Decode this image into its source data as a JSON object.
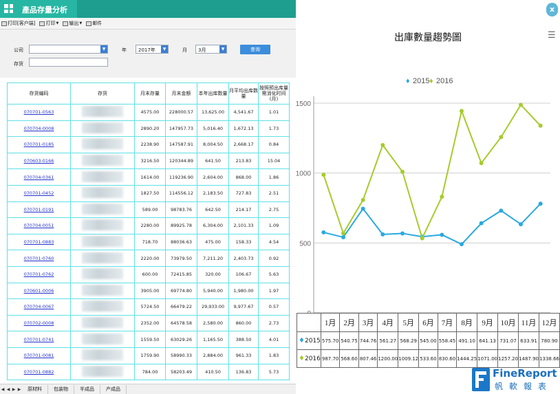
{
  "window": {
    "title": "產品存量分析"
  },
  "toolbar": {
    "print_client": "打印[客户端]",
    "print": "打印",
    "export": "输出",
    "email": "邮件"
  },
  "params": {
    "company_label": "公司",
    "company_value": "",
    "year_label": "年",
    "year_value": "2017年",
    "month_label": "月",
    "month_value": "3月",
    "query_button": "查询",
    "stock_label": "存货",
    "stock_value": ""
  },
  "grid": {
    "headers": [
      "存货编码",
      "存货",
      "月末存量",
      "月末金额",
      "本年出库数量",
      "月平均出库数量",
      "按照预出库量需消化时间(月)"
    ],
    "rows": [
      [
        "070701-0563",
        "",
        "4575.00",
        "228000.57",
        "13,625.00",
        "4,541.67",
        "1.01"
      ],
      [
        "070704-0008",
        "",
        "2890.20",
        "147957.73",
        "5,016.40",
        "1,672.13",
        "1.73"
      ],
      [
        "070701-0185",
        "",
        "2238.90",
        "147587.91",
        "8,004.50",
        "2,668.17",
        "0.84"
      ],
      [
        "070603-0166",
        "",
        "3216.50",
        "120344.89",
        "641.50",
        "213.83",
        "15.04"
      ],
      [
        "070704-0361",
        "",
        "1614.00",
        "119236.90",
        "2,604.00",
        "868.00",
        "1.86"
      ],
      [
        "070701-0452",
        "",
        "1827.50",
        "114556.12",
        "2,183.50",
        "727.83",
        "2.51"
      ],
      [
        "070701-0191",
        "",
        "589.00",
        "98783.76",
        "642.50",
        "214.17",
        "2.75"
      ],
      [
        "070704-0051",
        "",
        "2280.00",
        "89925.78",
        "6,304.00",
        "2,101.33",
        "1.09"
      ],
      [
        "070701-0883",
        "",
        "718.70",
        "88036.63",
        "475.00",
        "158.33",
        "4.54"
      ],
      [
        "070701-0760",
        "",
        "2220.00",
        "73979.50",
        "7,211.20",
        "2,403.73",
        "0.92"
      ],
      [
        "070701-0762",
        "",
        "600.00",
        "72415.85",
        "320.00",
        "106.67",
        "5.63"
      ],
      [
        "070601-0006",
        "",
        "3905.00",
        "69774.80",
        "5,940.00",
        "1,980.00",
        "1.97"
      ],
      [
        "070704-0067",
        "",
        "5724.50",
        "66479.22",
        "29,933.00",
        "9,977.67",
        "0.57"
      ],
      [
        "070702-0008",
        "",
        "2352.00",
        "64578.58",
        "2,580.00",
        "860.00",
        "2.73"
      ],
      [
        "070701-0741",
        "",
        "1559.50",
        "63029.26",
        "1,165.50",
        "388.50",
        "4.01"
      ],
      [
        "070701-0081",
        "",
        "1759.90",
        "58990.33",
        "2,884.00",
        "961.33",
        "1.83"
      ],
      [
        "070701-0882",
        "",
        "784.00",
        "58203.49",
        "410.50",
        "136.83",
        "5.73"
      ]
    ]
  },
  "sheet_tabs": [
    "原材料",
    "包装物",
    "半成品",
    "产成品"
  ],
  "chart_panel": {
    "close_label": "x",
    "menu_icon": "menu-icon"
  },
  "chart_data": {
    "type": "line",
    "title": "出庫數量趨勢圖",
    "categories": [
      "1月",
      "2月",
      "3月",
      "4月",
      "5月",
      "6月",
      "7月",
      "8月",
      "9月",
      "10月",
      "11月",
      "12月"
    ],
    "series": [
      {
        "name": "2015",
        "color": "#29a9e0",
        "values": [
          575.7,
          540.75,
          744.76,
          561.27,
          568.29,
          545.0,
          558.45,
          491.1,
          641.13,
          731.07,
          633.91,
          780.9
        ],
        "labels": [
          "575.70",
          "540.75",
          "744.76",
          "561.27",
          "568.29",
          "545.00",
          "558.45",
          "491.10",
          "641.13",
          "731.07",
          "633.91",
          "780.90"
        ]
      },
      {
        "name": "2016",
        "color": "#a6cb2c",
        "values": [
          987.7,
          568.6,
          807.46,
          1200.0,
          1009.12,
          533.6,
          830.6,
          1444.25,
          1071.0,
          1257.2,
          1487.9,
          1338.66
        ],
        "labels": [
          "987.70",
          "568.60",
          "807.46",
          "1200.00",
          "1009.12",
          "533.60",
          "830.60",
          "1444.25",
          "1071.00",
          "1257.20",
          "1487.90",
          "1338.66"
        ]
      }
    ],
    "yticks": [
      0,
      500,
      1000,
      1500
    ],
    "ylim": [
      0,
      1500
    ],
    "grid": true,
    "legend": "top-left"
  },
  "brand": {
    "name": "FineReport",
    "cn": "帆軟報表"
  }
}
